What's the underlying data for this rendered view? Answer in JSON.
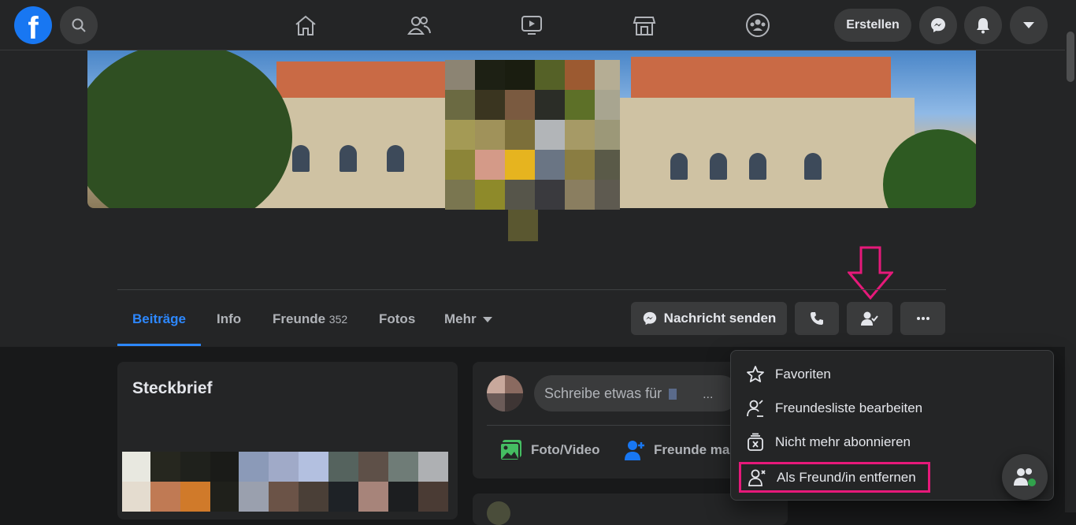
{
  "topbar": {
    "logo": "f",
    "create_label": "Erstellen",
    "icons": [
      "search-icon",
      "home-icon",
      "friends-icon",
      "watch-icon",
      "marketplace-icon",
      "groups-icon",
      "messenger-icon",
      "notifications-icon",
      "account-menu-icon"
    ]
  },
  "tabs": [
    {
      "label": "Beiträge",
      "active": true
    },
    {
      "label": "Info"
    },
    {
      "label": "Freunde",
      "count": "352"
    },
    {
      "label": "Fotos"
    },
    {
      "label": "Mehr"
    }
  ],
  "actions": {
    "message_label": "Nachricht senden"
  },
  "intro": {
    "title": "Steckbrief"
  },
  "composer": {
    "placeholder": "Schreibe etwas für",
    "ellipsis": "...",
    "photo_label": "Foto/Video",
    "tag_label": "Freunde ma"
  },
  "menu": {
    "items": [
      {
        "label": "Favoriten",
        "icon": "star-icon"
      },
      {
        "label": "Freundesliste bearbeiten",
        "icon": "edit-friend-list-icon"
      },
      {
        "label": "Nicht mehr abonnieren",
        "icon": "unfollow-icon"
      },
      {
        "label": "Als Freund/in entfernen",
        "icon": "unfriend-icon"
      }
    ]
  },
  "colors": {
    "accent": "#2d88ff",
    "highlight": "#e6197a",
    "background": "#18191a",
    "surface": "#242526"
  }
}
